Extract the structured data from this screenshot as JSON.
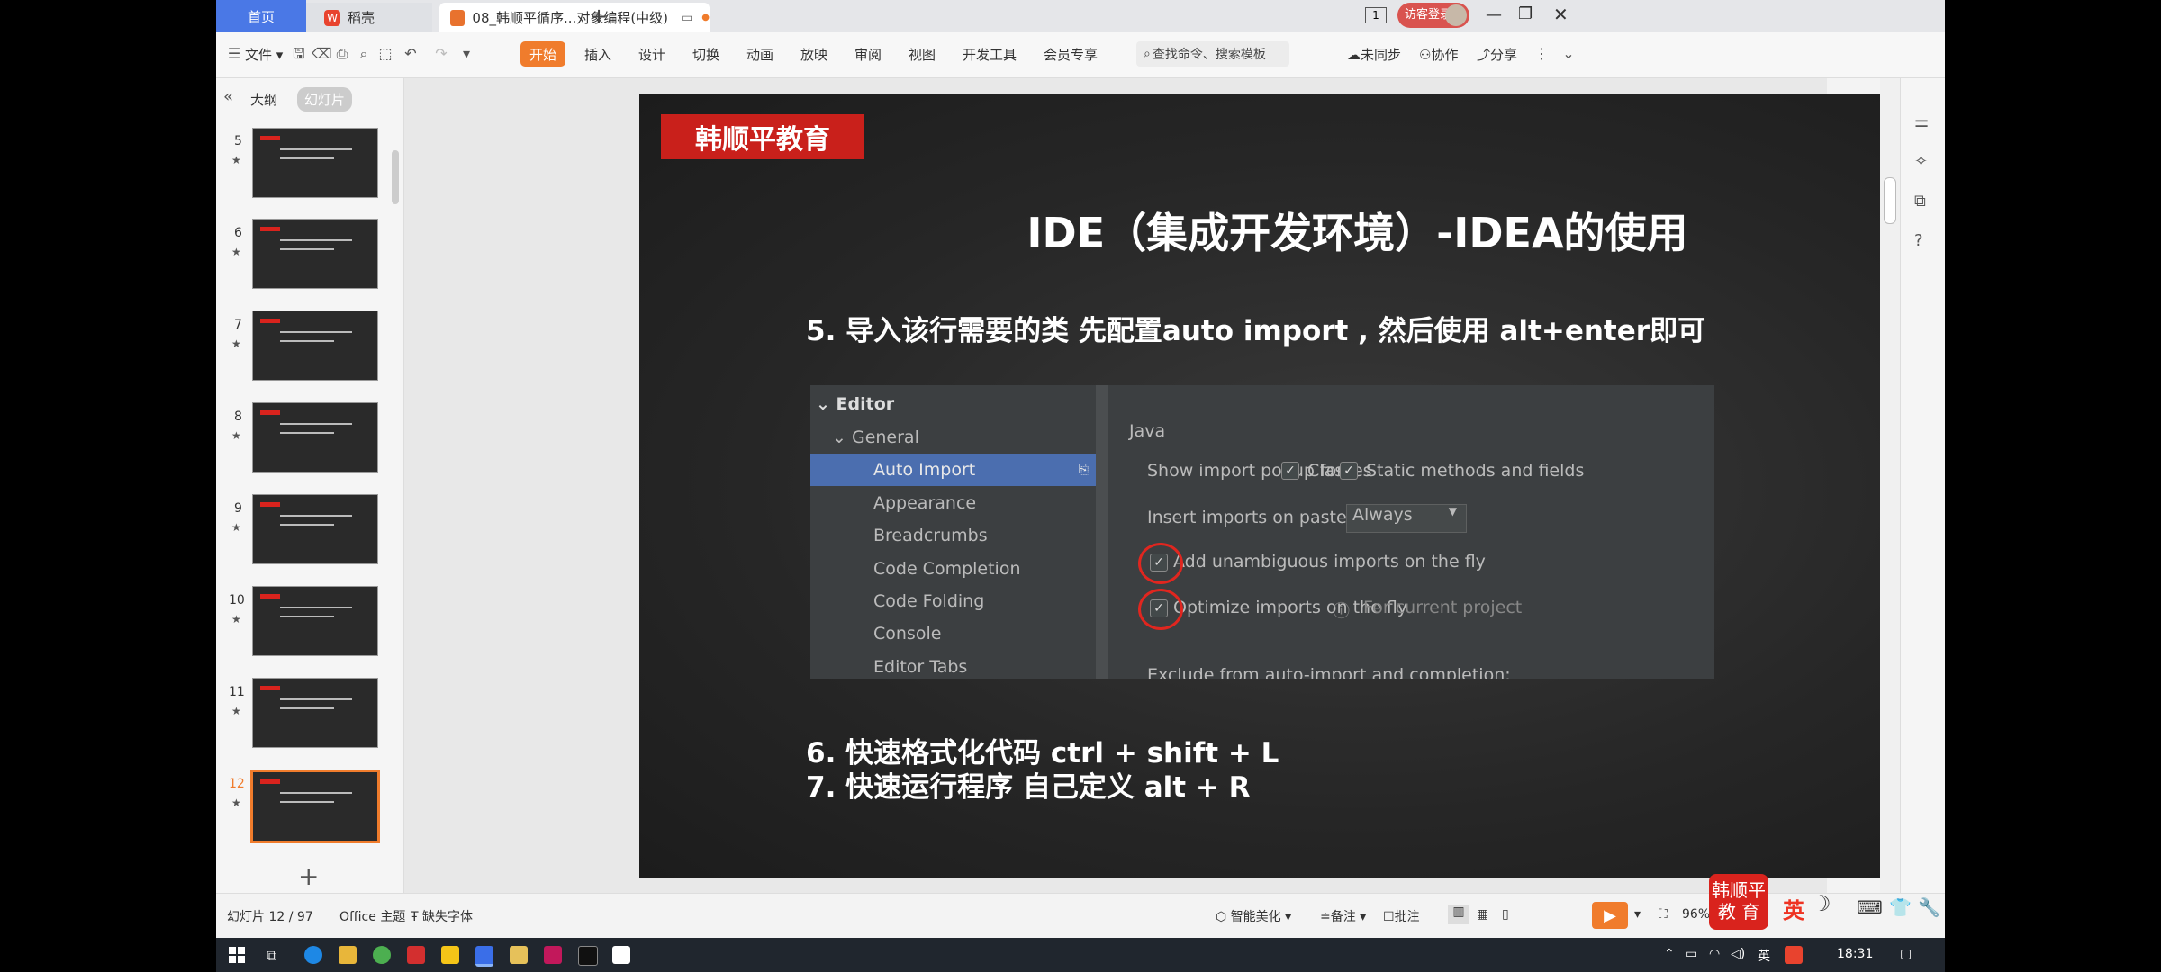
{
  "tabs": {
    "home": "首页",
    "wps": "稻壳",
    "doc": "08_韩顺平循序...对象编程(中级)",
    "new_tab": "+"
  },
  "window": {
    "page_badge": "1",
    "login": "访客登录"
  },
  "menu": {
    "file": "文件",
    "items": [
      "开始",
      "插入",
      "设计",
      "切换",
      "动画",
      "放映",
      "审阅",
      "视图",
      "开发工具",
      "会员专享"
    ],
    "search": "查找命令、搜索模板",
    "sync": "未同步",
    "collab": "协作",
    "share": "分享"
  },
  "left_panel": {
    "outline": "大纲",
    "slides_tab": "幻灯片",
    "slide_numbers": [
      "5",
      "6",
      "7",
      "8",
      "9",
      "10",
      "11",
      "12"
    ],
    "add": "+"
  },
  "slide": {
    "brand": "韩顺平教育",
    "title": "IDE（集成开发环境）-IDEA的使用",
    "line5": "5.   导入该行需要的类 先配置auto import , 然后使用 alt+enter即可",
    "line6": "6.   快速格式化代码 ctrl + shift + L",
    "line7": "7.   快速运行程序 自己定义 alt + R"
  },
  "ide": {
    "tree": [
      "Editor",
      "General",
      "Auto Import",
      "Appearance",
      "Breadcrumbs",
      "Code Completion",
      "Code Folding",
      "Console",
      "Editor Tabs"
    ],
    "section": "Java",
    "show_popup": "Show import popup for:",
    "classes": "Classes",
    "static": "Static methods and fields",
    "insert_paste": "Insert imports on paste:",
    "always": "Always",
    "add_unambiguous": "Add unambiguous imports on the fly",
    "optimize": "Optimize imports on the fly",
    "for_project": "For current project",
    "exclude": "Exclude from auto-import and completion:"
  },
  "status": {
    "slide_pos": "幻灯片 12 / 97",
    "theme": "Office 主题",
    "missing_font": "缺失字体",
    "beautify": "智能美化",
    "notes": "备注",
    "comments": "批注",
    "zoom": "96%"
  },
  "badge": {
    "line1": "韩顺平",
    "line2": "教  育",
    "ime": "英"
  },
  "taskbar": {
    "ime": "英",
    "time": "18:31"
  },
  "colors": {
    "accent": "#f07c2c",
    "brand_red": "#d9231d",
    "selection_blue": "#4b6eaf"
  }
}
